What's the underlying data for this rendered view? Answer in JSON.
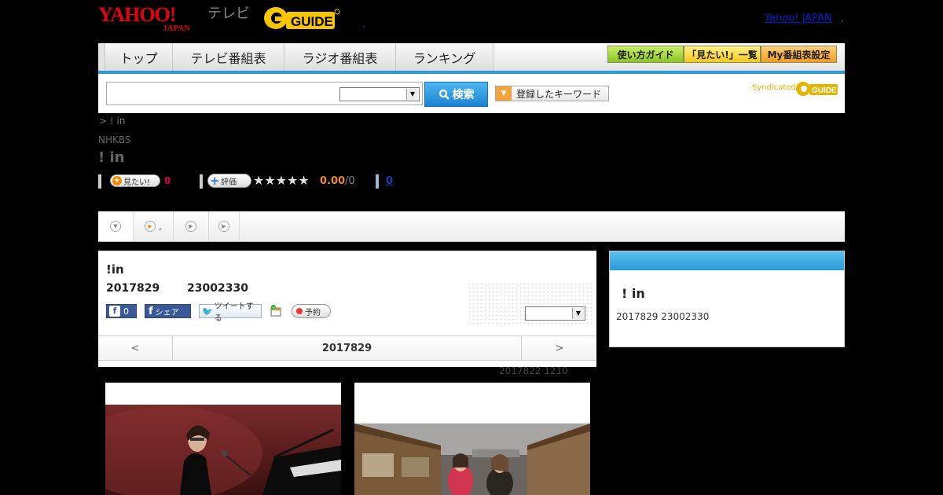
{
  "header": {
    "yahoo_logo": "YAHOO!",
    "yahoo_japan": "JAPAN",
    "tv_label": "テレビ",
    "gguide_logo": "G-GUIDE",
    "dot": ",",
    "yahoo_japan_link": "Yahoo! JAPAN",
    "link_dot": ","
  },
  "nav": {
    "tabs": [
      "トップ",
      "テレビ番組表",
      "ラジオ番組表",
      "ランキング"
    ],
    "buttons": [
      "使い方ガイド",
      "「見たい!」一覧",
      "My番組表設定"
    ]
  },
  "search": {
    "input_value": "",
    "select_value": "",
    "button_label": "検索",
    "keywords_label": "登録したキーワード",
    "syndicated_label": "Syndicated",
    "syndicated_logo": "G-GUIDE"
  },
  "program": {
    "breadcrumb": "> !  in",
    "station": "NHKBS",
    "title": "!   in",
    "want_label": "見たい!",
    "want_count": "0",
    "rate_label": "評価",
    "stars": "★★★★★",
    "rating": "0.00",
    "rating_count": "/0",
    "review_link": "0"
  },
  "tabs": {
    "tab2_suffix": ","
  },
  "episode": {
    "title": "!in",
    "date": "2017829",
    "time": "23002330",
    "fb_count": "0",
    "share_label": "シェア",
    "tweet_label": "ツイートする",
    "reserve_label": "予約",
    "select_value": "",
    "prev_arrow": "<",
    "nav_date": "2017829",
    "next_arrow": ">",
    "prev_broadcast": "2017822  1210"
  },
  "side": {
    "title": "!   in",
    "datetime": "2017829   23002330"
  },
  "colors": {
    "accent_blue": "#2a9ad6",
    "yahoo_red": "#e60012",
    "gguide_yellow": "#f7c600",
    "count_red": "#e0004c",
    "rating_orange": "#e88a30"
  }
}
